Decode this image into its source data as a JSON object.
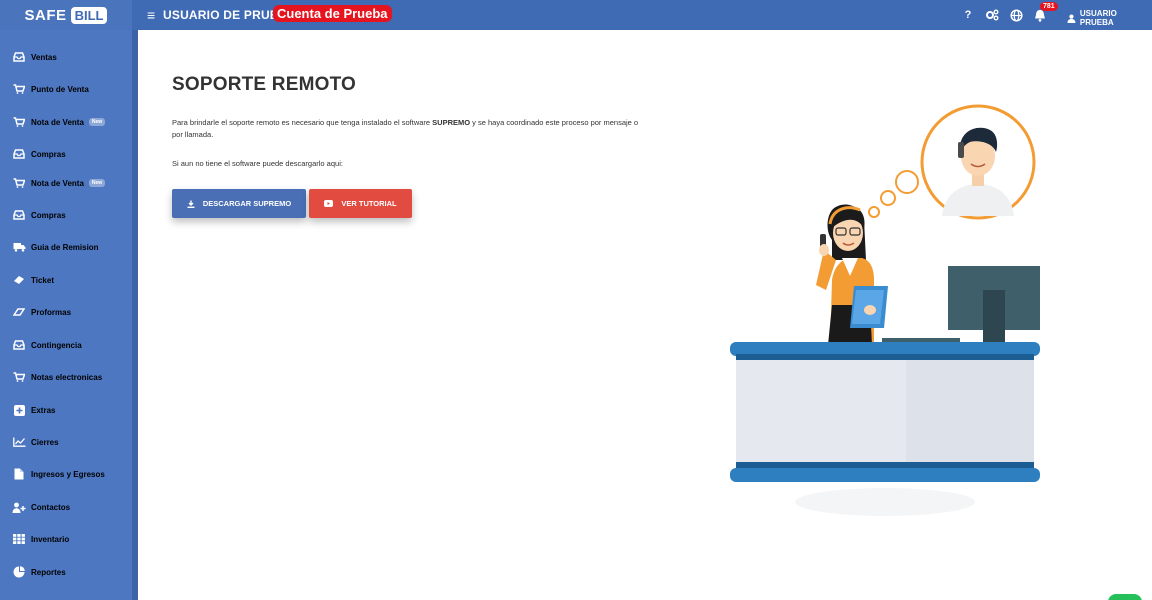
{
  "brand": {
    "part1": "SAFE",
    "part2": "BILL"
  },
  "header": {
    "menu_icon": "hamburger-icon",
    "user_title": "USUARIO DE PRUEBA",
    "account_badge": "Cuenta de Prueba",
    "help_icon": "question-icon",
    "help_glyph": "?",
    "settings_icon": "gears-icon",
    "globe_icon": "globe-icon",
    "notifications_icon": "bell-icon",
    "notification_count": "781",
    "user_icon": "user-icon",
    "user_name": "USUARIO PRUEBA"
  },
  "sidebar": {
    "items": [
      {
        "label": "Ventas",
        "icon": "inbox-icon"
      },
      {
        "label": "Punto de Venta",
        "icon": "cart-icon"
      },
      {
        "label": "Nota de Venta",
        "icon": "cart-icon",
        "badge": "New"
      },
      {
        "label": "Compras",
        "icon": "inbox-icon"
      },
      {
        "label": "Nota de Venta",
        "icon": "cart-icon",
        "badge": "New"
      },
      {
        "label": "Compras",
        "icon": "inbox-icon"
      },
      {
        "label": "Guia de Remision",
        "icon": "truck-icon"
      },
      {
        "label": "Ticket",
        "icon": "ticket-icon"
      },
      {
        "label": "Proformas",
        "icon": "eraser-icon"
      },
      {
        "label": "Contingencia",
        "icon": "inbox-icon"
      },
      {
        "label": "Notas electronicas",
        "icon": "cart-icon"
      },
      {
        "label": "Extras",
        "icon": "plus-square-icon"
      },
      {
        "label": "Cierres",
        "icon": "chart-line-icon"
      },
      {
        "label": "Ingresos y Egresos",
        "icon": "file-icon"
      },
      {
        "label": "Contactos",
        "icon": "user-plus-icon"
      },
      {
        "label": "Inventario",
        "icon": "grid-icon"
      },
      {
        "label": "Reportes",
        "icon": "pie-chart-icon"
      }
    ]
  },
  "main": {
    "title": "SOPORTE REMOTO",
    "desc_before": "Para brindarle el soporte remoto es necesario que tenga instalado el software ",
    "desc_bold": "SUPREMO",
    "desc_after": " y se haya coordinado este proceso por mensaje o por llamada.",
    "download_prompt": "Si aun no tiene el software puede descargarlo aqui:",
    "download_button": "DESCARGAR SUPREMO",
    "tutorial_button": "VER TUTORIAL"
  },
  "colors": {
    "topbar": "#3f6ab4",
    "sidebar": "#4d77c1",
    "badge_red": "#e5141f",
    "download_btn": "#4a6fb5",
    "tutorial_btn": "#e14b40",
    "illustration_orange": "#f39c33",
    "desk_blue": "#2e7fc0",
    "monitor": "#3f5f6a"
  }
}
